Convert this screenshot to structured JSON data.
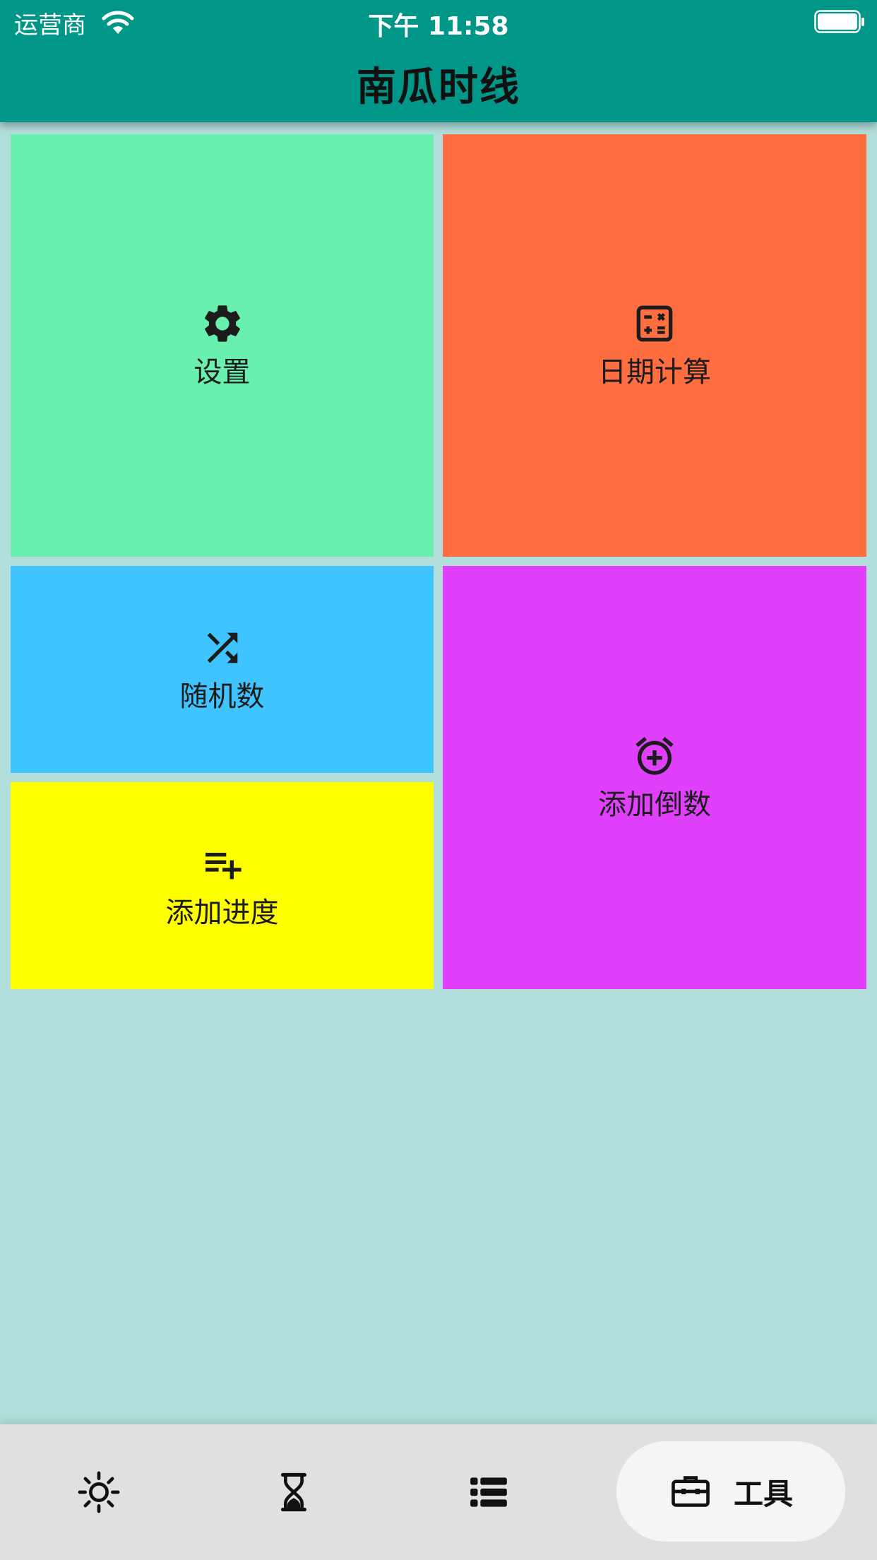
{
  "status_bar": {
    "carrier": "运营商",
    "time": "下午 11:58"
  },
  "app_bar": {
    "title": "南瓜时线"
  },
  "tiles": [
    {
      "label": "设置",
      "icon": "gear-icon",
      "color": "#69f0ae"
    },
    {
      "label": "日期计算",
      "icon": "calculator-icon",
      "color": "#ff6e40"
    },
    {
      "label": "随机数",
      "icon": "shuffle-icon",
      "color": "#40c4ff"
    },
    {
      "label": "添加进度",
      "icon": "playlist-add-icon",
      "color": "#ffff00"
    },
    {
      "label": "添加倒数",
      "icon": "alarm-add-icon",
      "color": "#e040fb"
    }
  ],
  "bottom_nav": {
    "items": [
      {
        "icon": "sun-icon"
      },
      {
        "icon": "hourglass-icon"
      },
      {
        "icon": "list-icon"
      },
      {
        "icon": "toolbox-icon",
        "label": "工具",
        "active": true
      }
    ]
  },
  "colors": {
    "primary": "#009688",
    "background": "#b2dfdb",
    "bottom_bar": "#e0e0e0"
  }
}
